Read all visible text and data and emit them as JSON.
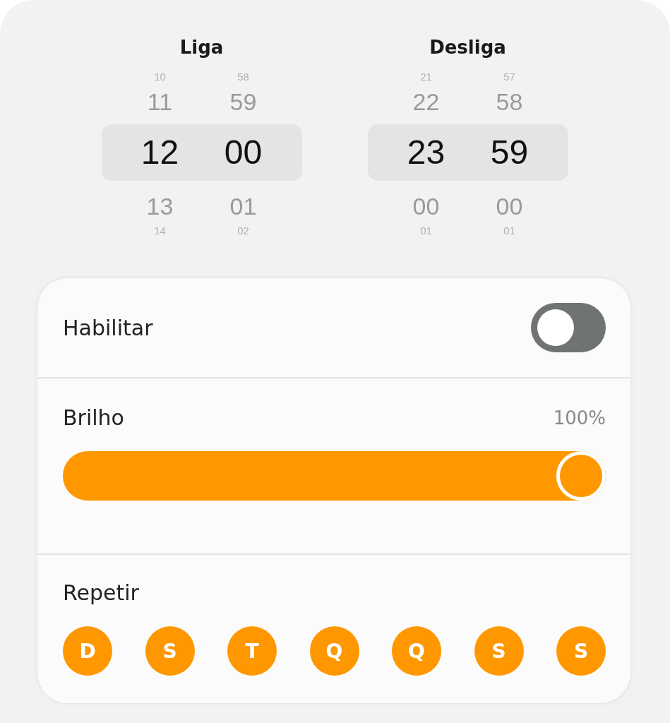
{
  "pickers": [
    {
      "title": "Liga",
      "rows": [
        {
          "kind": "far",
          "hour": "10",
          "minute": "58"
        },
        {
          "kind": "near",
          "hour": "11",
          "minute": "59"
        },
        {
          "kind": "current",
          "hour": "12",
          "minute": "00"
        },
        {
          "kind": "near",
          "hour": "13",
          "minute": "01"
        },
        {
          "kind": "far",
          "hour": "14",
          "minute": "02"
        }
      ]
    },
    {
      "title": "Desliga",
      "rows": [
        {
          "kind": "far",
          "hour": "21",
          "minute": "57"
        },
        {
          "kind": "near",
          "hour": "22",
          "minute": "58"
        },
        {
          "kind": "current",
          "hour": "23",
          "minute": "59"
        },
        {
          "kind": "near",
          "hour": "00",
          "minute": "00"
        },
        {
          "kind": "far",
          "hour": "01",
          "minute": "01"
        }
      ]
    }
  ],
  "enable": {
    "label": "Habilitar",
    "on": false
  },
  "brightness": {
    "label": "Brilho",
    "reading": "100%",
    "level": 1
  },
  "repeat": {
    "label": "Repetir",
    "days": [
      {
        "label": "D",
        "selected": true
      },
      {
        "label": "S",
        "selected": true
      },
      {
        "label": "T",
        "selected": true
      },
      {
        "label": "Q",
        "selected": true
      },
      {
        "label": "Q",
        "selected": true
      },
      {
        "label": "S",
        "selected": true
      },
      {
        "label": "S",
        "selected": true
      }
    ]
  }
}
